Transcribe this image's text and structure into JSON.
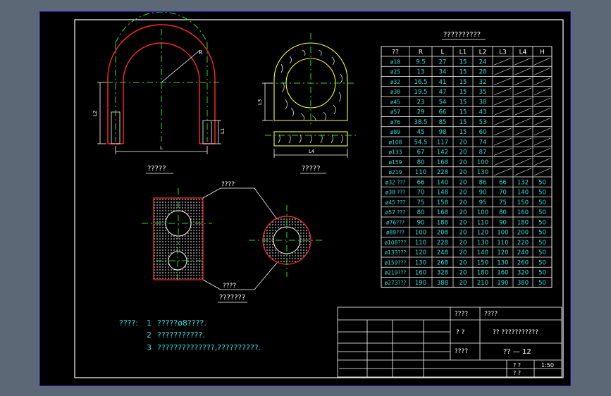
{
  "drawing": {
    "views": {
      "front_caption": "?????",
      "side_caption": "?????",
      "bottom_caption": "???????",
      "label_top": "????",
      "label_bottom": "????",
      "dim_L": "L",
      "dim_L1": "L1",
      "dim_L2": "L2",
      "dim_L3": "L3",
      "dim_L4": "L4",
      "dim_R": "R"
    },
    "table": {
      "title": "??????????",
      "headers": [
        "??",
        "R",
        "L",
        "L1",
        "L2",
        "L3",
        "L4",
        "H"
      ],
      "rows": [
        [
          "ø18",
          "9.5",
          "27",
          "15",
          "24",
          "",
          "",
          ""
        ],
        [
          "ø25",
          "13",
          "34",
          "15",
          "28",
          "",
          "",
          ""
        ],
        [
          "ø32",
          "16.5",
          "41",
          "15",
          "32",
          "",
          "",
          ""
        ],
        [
          "ø38",
          "19.5",
          "47",
          "15",
          "35",
          "",
          "",
          ""
        ],
        [
          "ø45",
          "23",
          "54",
          "15",
          "38",
          "",
          "",
          ""
        ],
        [
          "ø57",
          "29",
          "66",
          "15",
          "43",
          "",
          "",
          ""
        ],
        [
          "ø76",
          "38.5",
          "85",
          "15",
          "53",
          "",
          "",
          ""
        ],
        [
          "ø89",
          "45",
          "98",
          "15",
          "60",
          "",
          "",
          ""
        ],
        [
          "ø108",
          "54.5",
          "117",
          "20",
          "74",
          "",
          "",
          ""
        ],
        [
          "ø133",
          "67",
          "142",
          "20",
          "87",
          "",
          "",
          ""
        ],
        [
          "ø159",
          "80",
          "168",
          "20",
          "100",
          "",
          "",
          ""
        ],
        [
          "ø219",
          "110",
          "228",
          "20",
          "130",
          "",
          "",
          ""
        ],
        [
          "ø32 ???",
          "66",
          "140",
          "20",
          "86",
          "66",
          "132",
          "50"
        ],
        [
          "ø38 ???",
          "70",
          "148",
          "20",
          "90",
          "70",
          "140",
          "50"
        ],
        [
          "ø45 ???",
          "75",
          "158",
          "20",
          "95",
          "75",
          "150",
          "50"
        ],
        [
          "ø57 ???",
          "80",
          "168",
          "20",
          "100",
          "80",
          "160",
          "50"
        ],
        [
          "ø76???",
          "90",
          "188",
          "20",
          "110",
          "90",
          "180",
          "50"
        ],
        [
          "ø89???",
          "100",
          "208",
          "20",
          "120",
          "100",
          "200",
          "50"
        ],
        [
          "ø108???",
          "110",
          "228",
          "20",
          "130",
          "110",
          "220",
          "50"
        ],
        [
          "ø133???",
          "120",
          "248",
          "20",
          "140",
          "120",
          "240",
          "50"
        ],
        [
          "ø159???",
          "130",
          "268",
          "20",
          "150",
          "130",
          "260",
          "50"
        ],
        [
          "ø219???",
          "160",
          "328",
          "20",
          "180",
          "160",
          "320",
          "50"
        ],
        [
          "ø273???",
          "190",
          "388",
          "20",
          "210",
          "190",
          "380",
          "50"
        ]
      ]
    },
    "notes": {
      "heading": "????:",
      "items": [
        {
          "num": "1",
          "text": "?????ø8????."
        },
        {
          "num": "2",
          "text": "???????????."
        },
        {
          "num": "3",
          "text": "??????????????,??????????."
        }
      ]
    },
    "title_block": {
      "cell_a": "????",
      "cell_b": "????",
      "cell_c": "?   ?",
      "cell_d": "?? ???????????",
      "cell_e": "????",
      "drawing_no": "?? — 12",
      "cell_f": "?   ?",
      "cell_g": "?   ?",
      "scale": "1:50"
    },
    "colors": {
      "background": "#000000",
      "frame": "#ffffff",
      "pipe": "#ff2a2a",
      "centerline": "#22dd22",
      "insulation": "#ffff33",
      "text": "#33dddd",
      "page": "#5d6877"
    }
  }
}
